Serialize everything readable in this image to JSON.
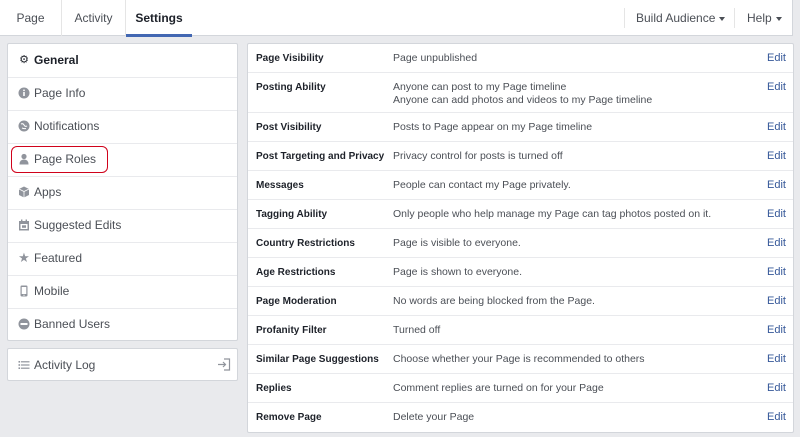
{
  "topbar": {
    "tabs": [
      {
        "label": "Page"
      },
      {
        "label": "Activity"
      },
      {
        "label": "Settings"
      }
    ],
    "build_audience": "Build Audience",
    "help": "Help"
  },
  "sidebar": {
    "items": [
      {
        "label": "General",
        "icon": "gear-icon"
      },
      {
        "label": "Page Info",
        "icon": "info-icon"
      },
      {
        "label": "Notifications",
        "icon": "globe-icon"
      },
      {
        "label": "Page Roles",
        "icon": "person-icon"
      },
      {
        "label": "Apps",
        "icon": "cube-icon"
      },
      {
        "label": "Suggested Edits",
        "icon": "calendar-icon"
      },
      {
        "label": "Featured",
        "icon": "star-icon"
      },
      {
        "label": "Mobile",
        "icon": "phone-icon"
      },
      {
        "label": "Banned Users",
        "icon": "ban-icon"
      }
    ],
    "activity_log": "Activity Log"
  },
  "settings": {
    "edit_label": "Edit",
    "rows": [
      {
        "name": "Page Visibility",
        "value": "Page unpublished",
        "value2": ""
      },
      {
        "name": "Posting Ability",
        "value": "Anyone can post to my Page timeline",
        "value2": "Anyone can add photos and videos to my Page timeline"
      },
      {
        "name": "Post Visibility",
        "value": "Posts to Page appear on my Page timeline",
        "value2": ""
      },
      {
        "name": "Post Targeting and Privacy",
        "value": "Privacy control for posts is turned off",
        "value2": ""
      },
      {
        "name": "Messages",
        "value": "People can contact my Page privately.",
        "value2": ""
      },
      {
        "name": "Tagging Ability",
        "value": "Only people who help manage my Page can tag photos posted on it.",
        "value2": ""
      },
      {
        "name": "Country Restrictions",
        "value": "Page is visible to everyone.",
        "value2": ""
      },
      {
        "name": "Age Restrictions",
        "value": "Page is shown to everyone.",
        "value2": ""
      },
      {
        "name": "Page Moderation",
        "value": "No words are being blocked from the Page.",
        "value2": ""
      },
      {
        "name": "Profanity Filter",
        "value": "Turned off",
        "value2": ""
      },
      {
        "name": "Similar Page Suggestions",
        "value": "Choose whether your Page is recommended to others",
        "value2": ""
      },
      {
        "name": "Replies",
        "value": "Comment replies are turned on for your Page",
        "value2": ""
      },
      {
        "name": "Remove Page",
        "value": "Delete your Page",
        "value2": ""
      }
    ]
  },
  "colors": {
    "accent": "#4267b2",
    "link": "#365899",
    "highlight": "#d0021b"
  }
}
